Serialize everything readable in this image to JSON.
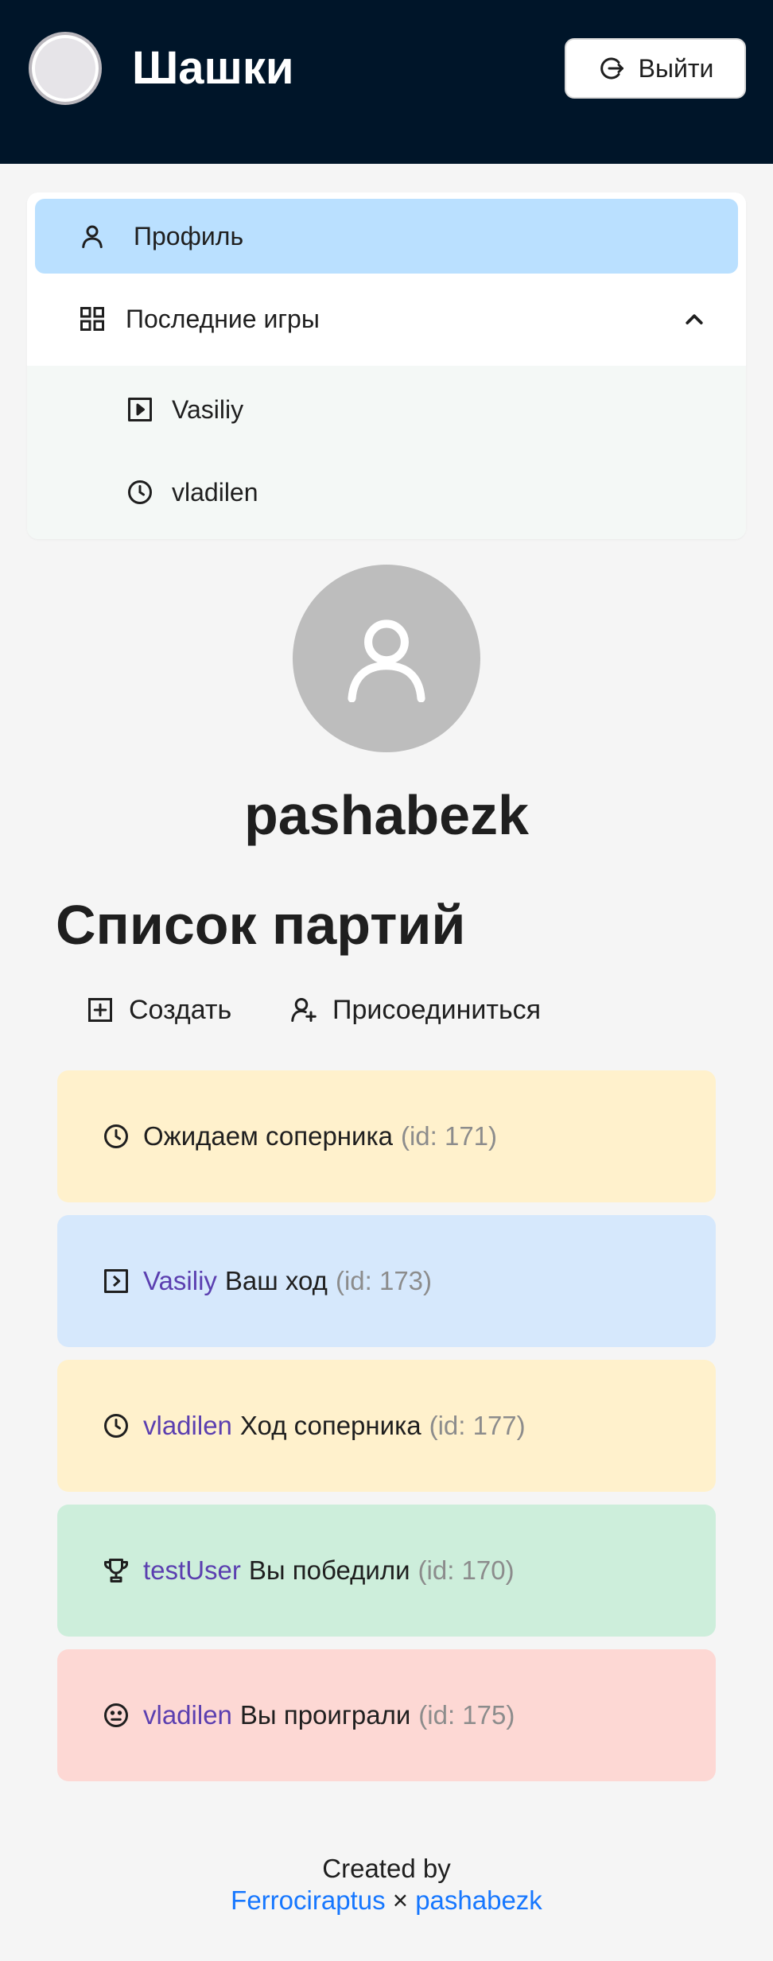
{
  "header": {
    "app_title": "Шашки",
    "logout_label": "Выйти"
  },
  "menu": {
    "profile_label": "Профиль",
    "recent_games_label": "Последние игры",
    "recent_games": [
      {
        "label": "Vasiliy",
        "icon": "play-square-icon"
      },
      {
        "label": "vladilen",
        "icon": "clock-icon"
      }
    ]
  },
  "profile": {
    "username": "pashabezk"
  },
  "games_section": {
    "title": "Список партий",
    "create_label": "Создать",
    "join_label": "Присоединиться"
  },
  "games": [
    {
      "opponent": "",
      "status": "Ожидаем соперника",
      "id_text": "(id: 171)",
      "icon": "clock-icon",
      "color": "#fff1cc"
    },
    {
      "opponent": "Vasiliy",
      "status": "Ваш ход",
      "id_text": "(id: 173)",
      "icon": "play-square-icon",
      "color": "#d6e8fc"
    },
    {
      "opponent": "vladilen",
      "status": "Ход соперника",
      "id_text": "(id: 177)",
      "icon": "clock-icon",
      "color": "#fff1cc"
    },
    {
      "opponent": "testUser",
      "status": "Вы победили",
      "id_text": "(id: 170)",
      "icon": "trophy-icon",
      "color": "#cdeedb"
    },
    {
      "opponent": "vladilen",
      "status": "Вы проиграли",
      "id_text": "(id: 175)",
      "icon": "frown-icon",
      "color": "#fdd8d4"
    }
  ],
  "footer": {
    "created_by": "Created by",
    "author1": "Ferrociraptus",
    "separator": "×",
    "author2": "pashabezk"
  },
  "colors": {
    "header_bg": "#001529",
    "menu_selected": "#bae0ff",
    "link": "#1677ff",
    "opponent": "#5b3fb0"
  }
}
